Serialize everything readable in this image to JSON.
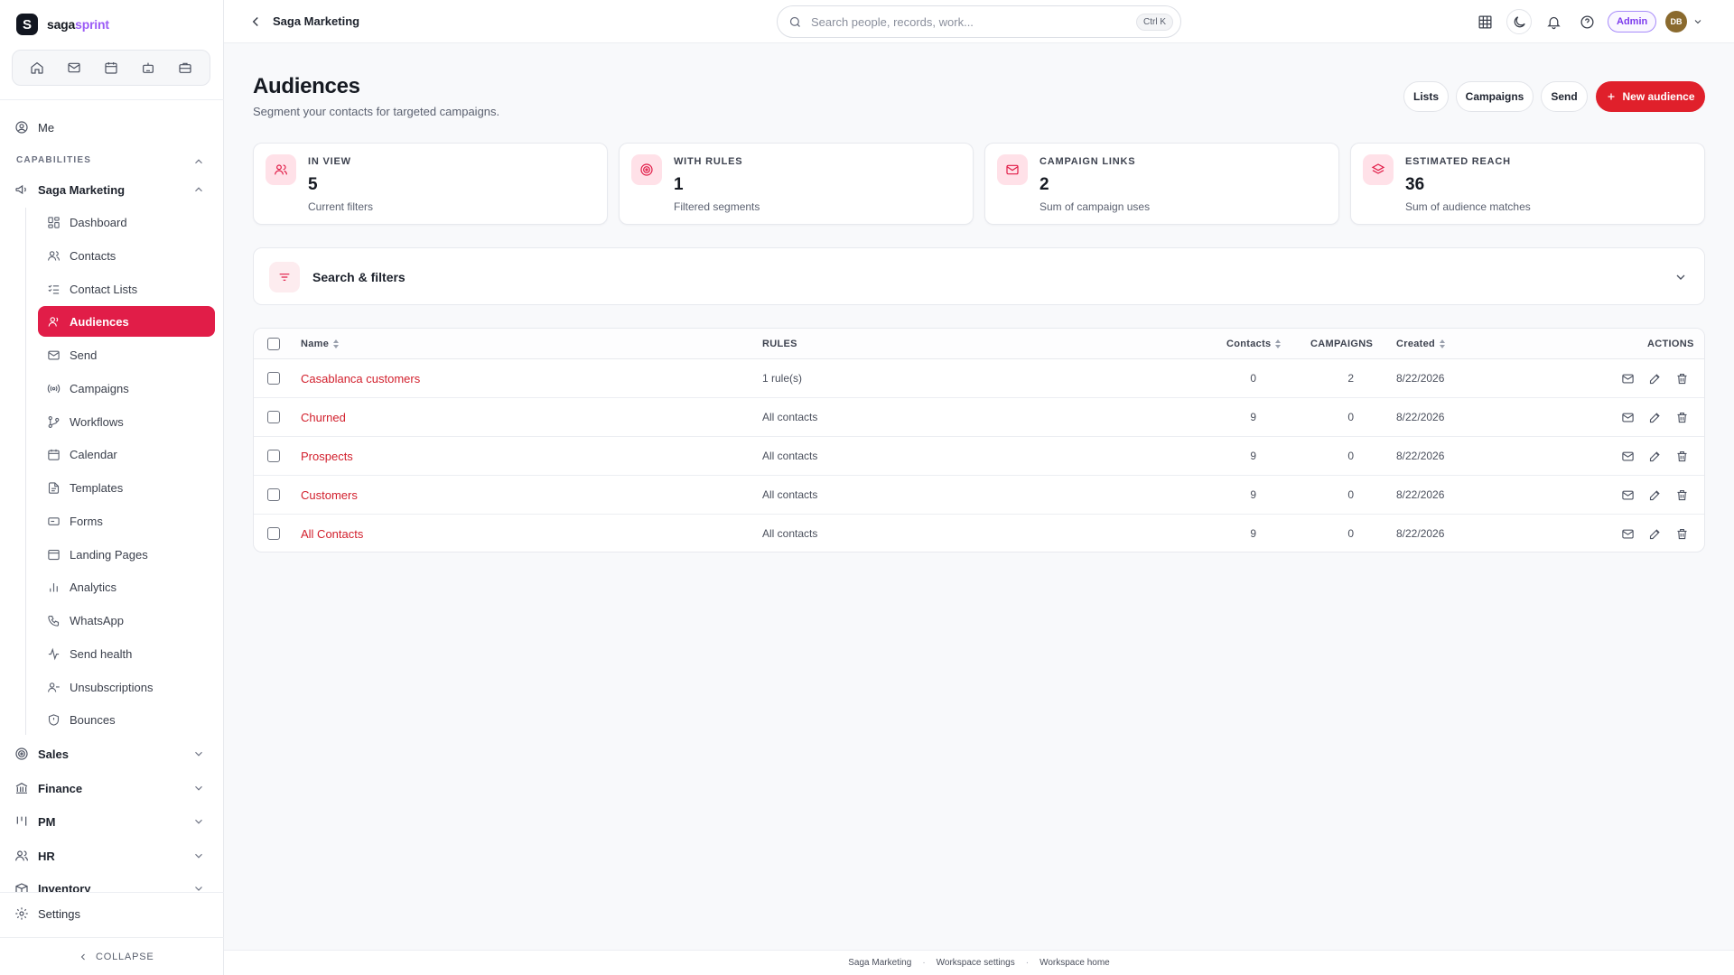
{
  "brand": {
    "prefix": "saga",
    "suffix": "sprint",
    "logo_letter": "S",
    "accent": "#9b5cf6"
  },
  "sidebar": {
    "quick_icons": [
      "home-icon",
      "mail-icon",
      "calendar-icon",
      "bot-icon",
      "briefcase-icon"
    ],
    "me_label": "Me",
    "capabilities_label": "CAPABILITIES",
    "group_label": "Saga Marketing",
    "items": [
      {
        "label": "Dashboard",
        "icon": "dashboard-icon"
      },
      {
        "label": "Contacts",
        "icon": "users-icon"
      },
      {
        "label": "Contact Lists",
        "icon": "list-checks-icon"
      },
      {
        "label": "Audiences",
        "icon": "user-audience-icon",
        "active": true
      },
      {
        "label": "Send",
        "icon": "mail-icon"
      },
      {
        "label": "Campaigns",
        "icon": "broadcast-icon"
      },
      {
        "label": "Workflows",
        "icon": "workflow-icon"
      },
      {
        "label": "Calendar",
        "icon": "calendar-icon"
      },
      {
        "label": "Templates",
        "icon": "file-text-icon"
      },
      {
        "label": "Forms",
        "icon": "form-icon"
      },
      {
        "label": "Landing Pages",
        "icon": "layout-icon"
      },
      {
        "label": "Analytics",
        "icon": "bar-chart-icon"
      },
      {
        "label": "WhatsApp",
        "icon": "phone-icon"
      },
      {
        "label": "Send health",
        "icon": "activity-icon"
      },
      {
        "label": "Unsubscriptions",
        "icon": "user-minus-icon"
      },
      {
        "label": "Bounces",
        "icon": "shield-icon"
      }
    ],
    "sections": [
      {
        "label": "Sales",
        "icon": "target-icon"
      },
      {
        "label": "Finance",
        "icon": "bank-icon"
      },
      {
        "label": "PM",
        "icon": "kanban-icon"
      },
      {
        "label": "HR",
        "icon": "people-icon"
      },
      {
        "label": "Inventory",
        "icon": "box-icon"
      }
    ],
    "settings_label": "Settings",
    "collapse_label": "COLLAPSE"
  },
  "topbar": {
    "breadcrumb": "Saga Marketing",
    "search_placeholder": "Search people, records, work...",
    "search_shortcut": "Ctrl K",
    "role_badge": "Admin",
    "avatar_initials": "DB"
  },
  "page": {
    "title": "Audiences",
    "subtitle": "Segment your contacts for targeted campaigns.",
    "buttons": {
      "lists": "Lists",
      "campaigns": "Campaigns",
      "send": "Send",
      "new": "New audience"
    }
  },
  "stats": [
    {
      "label": "IN VIEW",
      "value": "5",
      "desc": "Current filters",
      "icon": "users-icon"
    },
    {
      "label": "WITH RULES",
      "value": "1",
      "desc": "Filtered segments",
      "icon": "target-icon"
    },
    {
      "label": "CAMPAIGN LINKS",
      "value": "2",
      "desc": "Sum of campaign uses",
      "icon": "mail-icon"
    },
    {
      "label": "ESTIMATED REACH",
      "value": "36",
      "desc": "Sum of audience matches",
      "icon": "layers-icon"
    }
  ],
  "filters": {
    "title": "Search & filters"
  },
  "table": {
    "headers": {
      "name": "Name",
      "rules": "RULES",
      "contacts": "Contacts",
      "campaigns": "CAMPAIGNS",
      "created": "Created",
      "actions": "ACTIONS"
    },
    "rows": [
      {
        "name": "Casablanca customers",
        "rules": "1 rule(s)",
        "contacts": "0",
        "campaigns": "2",
        "created": "8/22/2026"
      },
      {
        "name": "Churned",
        "rules": "All contacts",
        "contacts": "9",
        "campaigns": "0",
        "created": "8/22/2026"
      },
      {
        "name": "Prospects",
        "rules": "All contacts",
        "contacts": "9",
        "campaigns": "0",
        "created": "8/22/2026"
      },
      {
        "name": "Customers",
        "rules": "All contacts",
        "contacts": "9",
        "campaigns": "0",
        "created": "8/22/2026"
      },
      {
        "name": "All Contacts",
        "rules": "All contacts",
        "contacts": "9",
        "campaigns": "0",
        "created": "8/22/2026"
      }
    ]
  },
  "footer": {
    "links": [
      "Saga Marketing",
      "Workspace settings",
      "Workspace home"
    ]
  },
  "colors": {
    "primary": "#e11d48",
    "new_button": "#e0202b",
    "admin_badge": "#7c3aed"
  }
}
